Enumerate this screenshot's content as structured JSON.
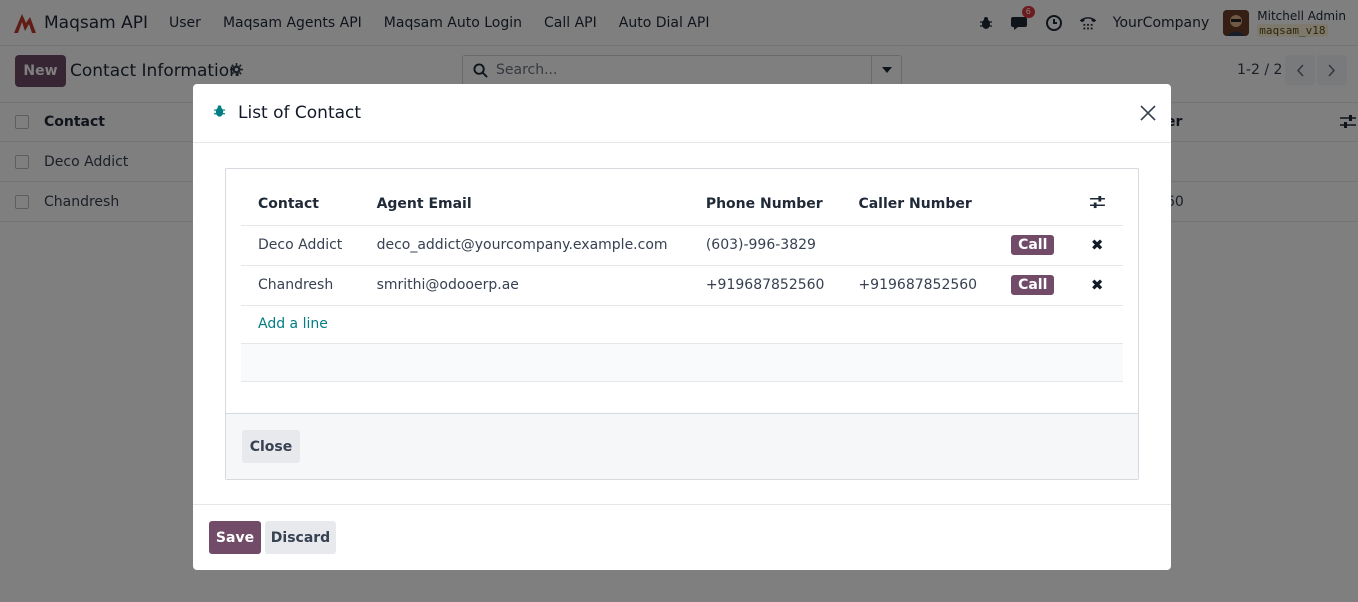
{
  "navbar": {
    "app_name": "Maqsam API",
    "menu": [
      "User",
      "Maqsam Agents API",
      "Maqsam Auto Login",
      "Call API",
      "Auto Dial API"
    ],
    "message_count": "6",
    "company": "YourCompany",
    "user_name": "Mitchell Admin",
    "db_name": "maqsam_v18"
  },
  "control": {
    "new_label": "New",
    "title": "Contact Information",
    "search_placeholder": "Search...",
    "pager": "1-2 / 2"
  },
  "background_list": {
    "header": "Contact",
    "header_right": "er",
    "rows": [
      {
        "name": "Deco Addict",
        "right": ""
      },
      {
        "name": "Chandresh",
        "right": "60"
      }
    ]
  },
  "dialog": {
    "title": "List of Contact",
    "columns": [
      "Contact",
      "Agent Email",
      "Phone Number",
      "Caller Number"
    ],
    "rows": [
      {
        "contact": "Deco Addict",
        "email": "deco_addict@yourcompany.example.com",
        "phone": "(603)-996-3829",
        "caller": "",
        "call_label": "Call"
      },
      {
        "contact": "Chandresh",
        "email": "smrithi@odooerp.ae",
        "phone": "+919687852560",
        "caller": "+919687852560",
        "call_label": "Call"
      }
    ],
    "add_line": "Add a line",
    "close_label": "Close",
    "save_label": "Save",
    "discard_label": "Discard"
  },
  "colors": {
    "primary": "#714b67",
    "link": "#017e84",
    "badge": "#d9363e"
  }
}
